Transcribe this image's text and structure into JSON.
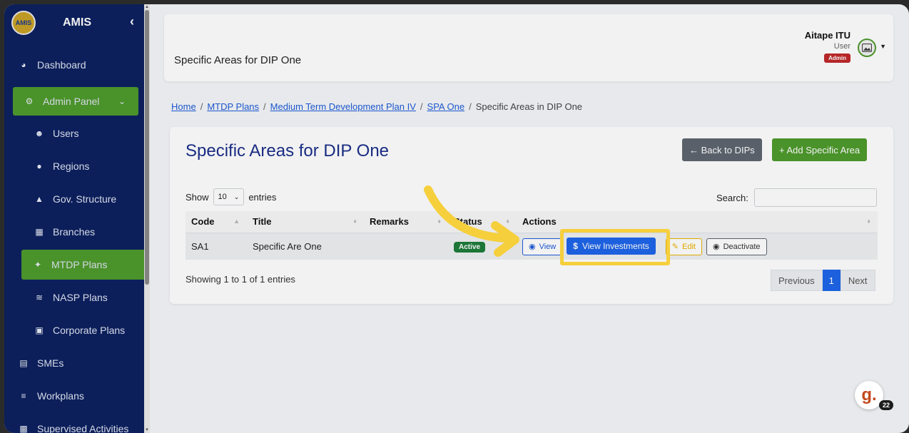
{
  "sidebar": {
    "brand": "AMIS",
    "logo_text": "AMIS",
    "toggle_icon": "chevron-left-icon",
    "items": [
      {
        "label": "Dashboard",
        "icon": "dashboard-icon"
      },
      {
        "label": "Admin Panel",
        "icon": "gear-icon"
      },
      {
        "label": "Users",
        "icon": "users-icon"
      },
      {
        "label": "Regions",
        "icon": "map-pin-icon"
      },
      {
        "label": "Gov. Structure",
        "icon": "sitemap-icon"
      },
      {
        "label": "Branches",
        "icon": "building-icon"
      },
      {
        "label": "MTDP Plans",
        "icon": "tree-icon"
      },
      {
        "label": "NASP Plans",
        "icon": "chart-line-icon"
      },
      {
        "label": "Corporate Plans",
        "icon": "briefcase-icon"
      },
      {
        "label": "SMEs",
        "icon": "store-icon"
      },
      {
        "label": "Workplans",
        "icon": "list-check-icon"
      },
      {
        "label": "Supervised Activities",
        "icon": "clipboard-icon"
      }
    ]
  },
  "topbar": {
    "title": "Specific Areas for DIP One",
    "user_name": "Aitape ITU",
    "user_role": "User",
    "user_badge": "Admin"
  },
  "breadcrumb": {
    "home": "Home",
    "mtdp": "MTDP Plans",
    "plan": "Medium Term Development Plan IV",
    "spa": "SPA One",
    "current": "Specific Areas in DIP One",
    "separator": "/"
  },
  "card": {
    "title": "Specific Areas for DIP One",
    "back_button": "← Back to DIPs",
    "add_button": "+ Add Specific Area",
    "show_label": "Show",
    "entries_value": "10",
    "entries_label": "entries",
    "search_label": "Search:",
    "search_value": "",
    "showing_text": "Showing 1 to 1 of 1 entries",
    "pager": {
      "previous": "Previous",
      "page": "1",
      "next": "Next"
    }
  },
  "table": {
    "headers": [
      "Code",
      "Title",
      "Remarks",
      "Status",
      "Actions"
    ],
    "rows": [
      {
        "code": "SA1",
        "title": "Specific Are One",
        "remarks": "",
        "status": "Active",
        "actions": {
          "view": "View",
          "view_investments": "View Investments",
          "edit": "Edit",
          "deactivate": "Deactivate"
        }
      }
    ]
  },
  "overlay": {
    "guide_letter": "g.",
    "guide_count": "22",
    "highlight_color": "#f6cf3c",
    "arrow_color": "#f6cf3c"
  },
  "colors": {
    "sidebar_bg": "#0d2160",
    "active_green": "#4f9a2d",
    "title_blue": "#1b2f8a",
    "primary_blue": "#1e66ea"
  }
}
